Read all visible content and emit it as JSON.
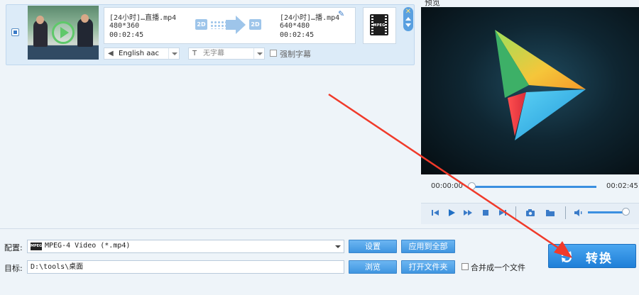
{
  "file_list": {
    "item": {
      "source": {
        "name": "[24小时]…直播.mp4",
        "resolution": "480*360",
        "duration": "00:02:45"
      },
      "output": {
        "name": "[24小时]…播.mp4",
        "resolution": "640*480",
        "duration": "00:02:45"
      },
      "badge_in": "2D",
      "badge_out": "2D",
      "format_badge": "MPEG",
      "audio_track": "English aac",
      "subtitle": "无字幕",
      "forced_subtitle_label": "强制字幕"
    },
    "delete_glyph": "✕"
  },
  "preview": {
    "title": "预览",
    "time_current": "00:00:00",
    "time_total": "00:02:45",
    "progress": 0.0,
    "volume": 0.92
  },
  "config": {
    "profile_label": "配置:",
    "profile_icon_text": "MPEG",
    "profile_value": "MPEG-4 Video (*.mp4)",
    "settings_button": "设置",
    "apply_all_button": "应用到全部",
    "destination_label": "目标:",
    "destination_value": "D:\\tools\\桌面",
    "browse_button": "浏览",
    "open_folder_button": "打开文件夹",
    "merge_label": "合并成一个文件",
    "convert_button": "转换"
  },
  "colors": {
    "accent": "#3f95e0",
    "annotation_arrow": "#f03a2a"
  }
}
